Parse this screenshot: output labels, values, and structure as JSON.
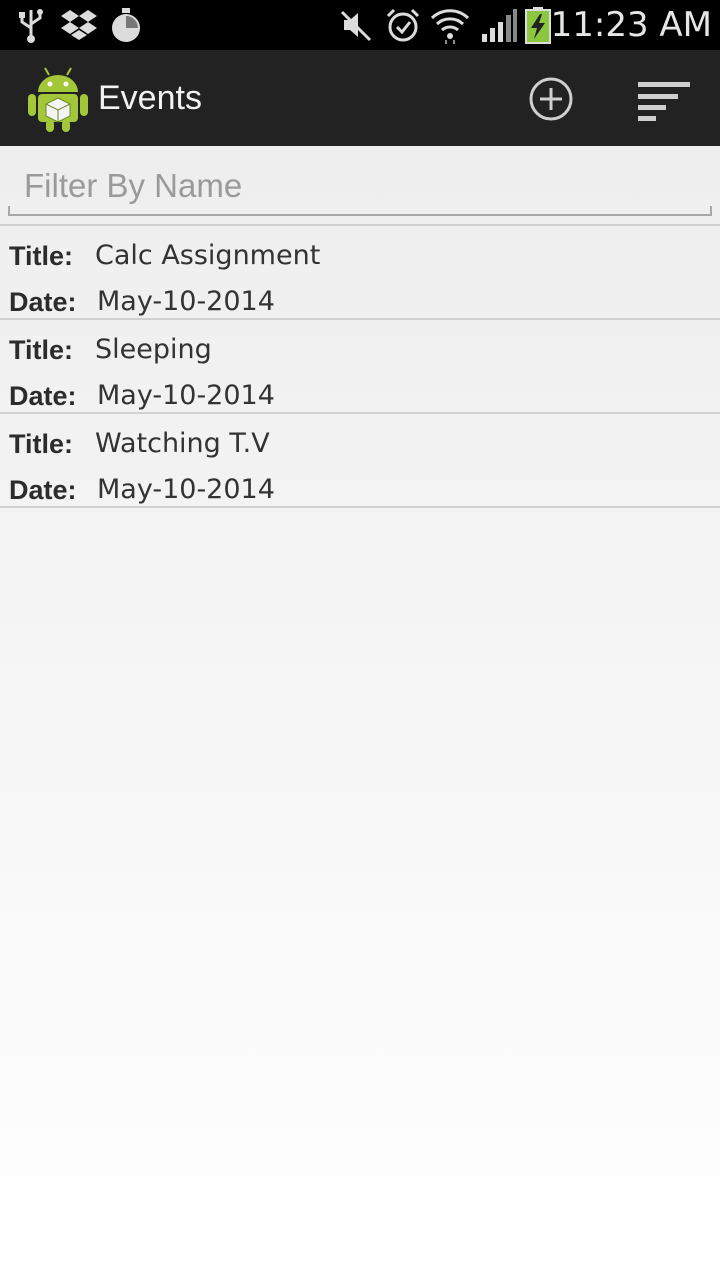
{
  "status_bar": {
    "time": "11:23 AM",
    "left_icons": [
      "usb-icon",
      "dropbox-icon",
      "timer-icon"
    ],
    "right_icons": [
      "mute-icon",
      "alarm-icon",
      "wifi-icon",
      "signal-icon",
      "battery-charging-icon"
    ]
  },
  "action_bar": {
    "title": "Events",
    "app_icon": "android-robot-icon",
    "actions": [
      "add-circle-icon",
      "sort-icon"
    ],
    "background": "#222222"
  },
  "filter": {
    "placeholder": "Filter By Name",
    "value": ""
  },
  "events": [
    {
      "title_label": "Title:",
      "title": "Calc Assignment",
      "date_label": "Date:",
      "date": "May-10-2014"
    },
    {
      "title_label": "Title:",
      "title": "Sleeping",
      "date_label": "Date:",
      "date": "May-10-2014"
    },
    {
      "title_label": "Title:",
      "title": "Watching T.V",
      "date_label": "Date:",
      "date": "May-10-2014"
    }
  ]
}
